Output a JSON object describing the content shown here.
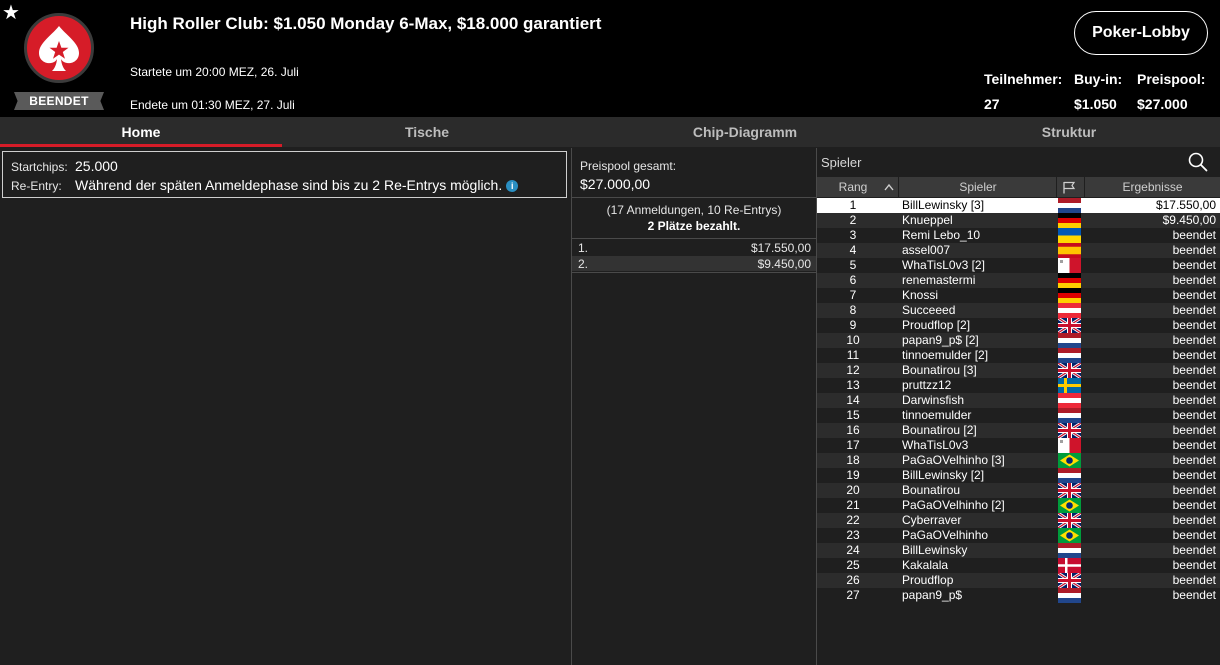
{
  "header": {
    "favorite_icon": "star-icon",
    "logo_icon": "pokerstars-spade-logo",
    "status": "BEENDET",
    "title": "High Roller Club: $1.050 Monday 6-Max, $18.000 garantiert",
    "started": "Startete um 20:00 MEZ, 26. Juli",
    "ended": "Endete um 01:30 MEZ, 27. Juli",
    "lobby_button": "Poker-Lobby",
    "stats": {
      "entrants_label": "Teilnehmer:",
      "entrants_value": "27",
      "buyin_label": "Buy-in:",
      "buyin_value": "$1.050",
      "prizepool_label": "Preispool:",
      "prizepool_value": "$27.000"
    }
  },
  "tabs": [
    {
      "label": "Home",
      "active": true
    },
    {
      "label": "Tische",
      "active": false
    },
    {
      "label": "Chip-Diagramm",
      "active": false
    },
    {
      "label": "Struktur",
      "active": false
    }
  ],
  "home": {
    "startchips_label": "Startchips:",
    "startchips_value": "25.000",
    "reentry_label": "Re-Entry:",
    "reentry_value": "Während der späten Anmeldephase sind bis zu 2 Re-Entrys möglich.",
    "info_icon": "info-icon"
  },
  "prizepool": {
    "label": "Preispool gesamt:",
    "value": "$27.000,00",
    "registrations": "(17 Anmeldungen, 10 Re-Entrys)",
    "paid": "2 Plätze bezahlt.",
    "payouts": [
      {
        "place": "1.",
        "amount": "$17.550,00"
      },
      {
        "place": "2.",
        "amount": "$9.450,00"
      }
    ]
  },
  "players": {
    "search_placeholder": "Spieler",
    "columns": {
      "rank": "Rang",
      "player": "Spieler",
      "country": "flag-icon",
      "result": "Ergebnisse"
    },
    "sort_icon": "chevron-up-icon",
    "rows": [
      {
        "rank": "1",
        "name": "BillLewinsky [3]",
        "flag": "nl",
        "result": "$17.550,00",
        "selected": true
      },
      {
        "rank": "2",
        "name": "Knueppel",
        "flag": "de",
        "result": "$9.450,00"
      },
      {
        "rank": "3",
        "name": "Remi Lebo_10",
        "flag": "ua",
        "result": "beendet"
      },
      {
        "rank": "4",
        "name": "assel007",
        "flag": "es",
        "result": "beendet"
      },
      {
        "rank": "5",
        "name": "WhaTisL0v3 [2]",
        "flag": "mt",
        "result": "beendet"
      },
      {
        "rank": "6",
        "name": "renemastermi",
        "flag": "de",
        "result": "beendet"
      },
      {
        "rank": "7",
        "name": "Knossi",
        "flag": "de",
        "result": "beendet"
      },
      {
        "rank": "8",
        "name": "Succeeed",
        "flag": "at",
        "result": "beendet"
      },
      {
        "rank": "9",
        "name": "Proudflop [2]",
        "flag": "gb",
        "result": "beendet"
      },
      {
        "rank": "10",
        "name": "papan9_p$ [2]",
        "flag": "nl",
        "result": "beendet"
      },
      {
        "rank": "11",
        "name": "tinnoemulder [2]",
        "flag": "nl",
        "result": "beendet"
      },
      {
        "rank": "12",
        "name": "Bounatirou [3]",
        "flag": "gb",
        "result": "beendet"
      },
      {
        "rank": "13",
        "name": "pruttzz12",
        "flag": "se",
        "result": "beendet"
      },
      {
        "rank": "14",
        "name": "Darwinsfish",
        "flag": "at",
        "result": "beendet"
      },
      {
        "rank": "15",
        "name": "tinnoemulder",
        "flag": "nl",
        "result": "beendet"
      },
      {
        "rank": "16",
        "name": "Bounatirou [2]",
        "flag": "gb",
        "result": "beendet"
      },
      {
        "rank": "17",
        "name": "WhaTisL0v3",
        "flag": "mt",
        "result": "beendet"
      },
      {
        "rank": "18",
        "name": "PaGaOVelhinho [3]",
        "flag": "br",
        "result": "beendet"
      },
      {
        "rank": "19",
        "name": "BillLewinsky [2]",
        "flag": "nl",
        "result": "beendet"
      },
      {
        "rank": "20",
        "name": "Bounatirou",
        "flag": "gb",
        "result": "beendet"
      },
      {
        "rank": "21",
        "name": "PaGaOVelhinho [2]",
        "flag": "br",
        "result": "beendet"
      },
      {
        "rank": "22",
        "name": "Cyberraver",
        "flag": "gb",
        "result": "beendet"
      },
      {
        "rank": "23",
        "name": "PaGaOVelhinho",
        "flag": "br",
        "result": "beendet"
      },
      {
        "rank": "24",
        "name": "BillLewinsky",
        "flag": "nl",
        "result": "beendet"
      },
      {
        "rank": "25",
        "name": "Kakalala",
        "flag": "dk",
        "result": "beendet"
      },
      {
        "rank": "26",
        "name": "Proudflop",
        "flag": "gb",
        "result": "beendet"
      },
      {
        "rank": "27",
        "name": "papan9_p$",
        "flag": "nl",
        "result": "beendet"
      }
    ]
  },
  "colors": {
    "accent": "#d61c28",
    "header_bg": "#000000",
    "panel_bg": "#1f1f1f",
    "selected_row": "#ffffff"
  }
}
